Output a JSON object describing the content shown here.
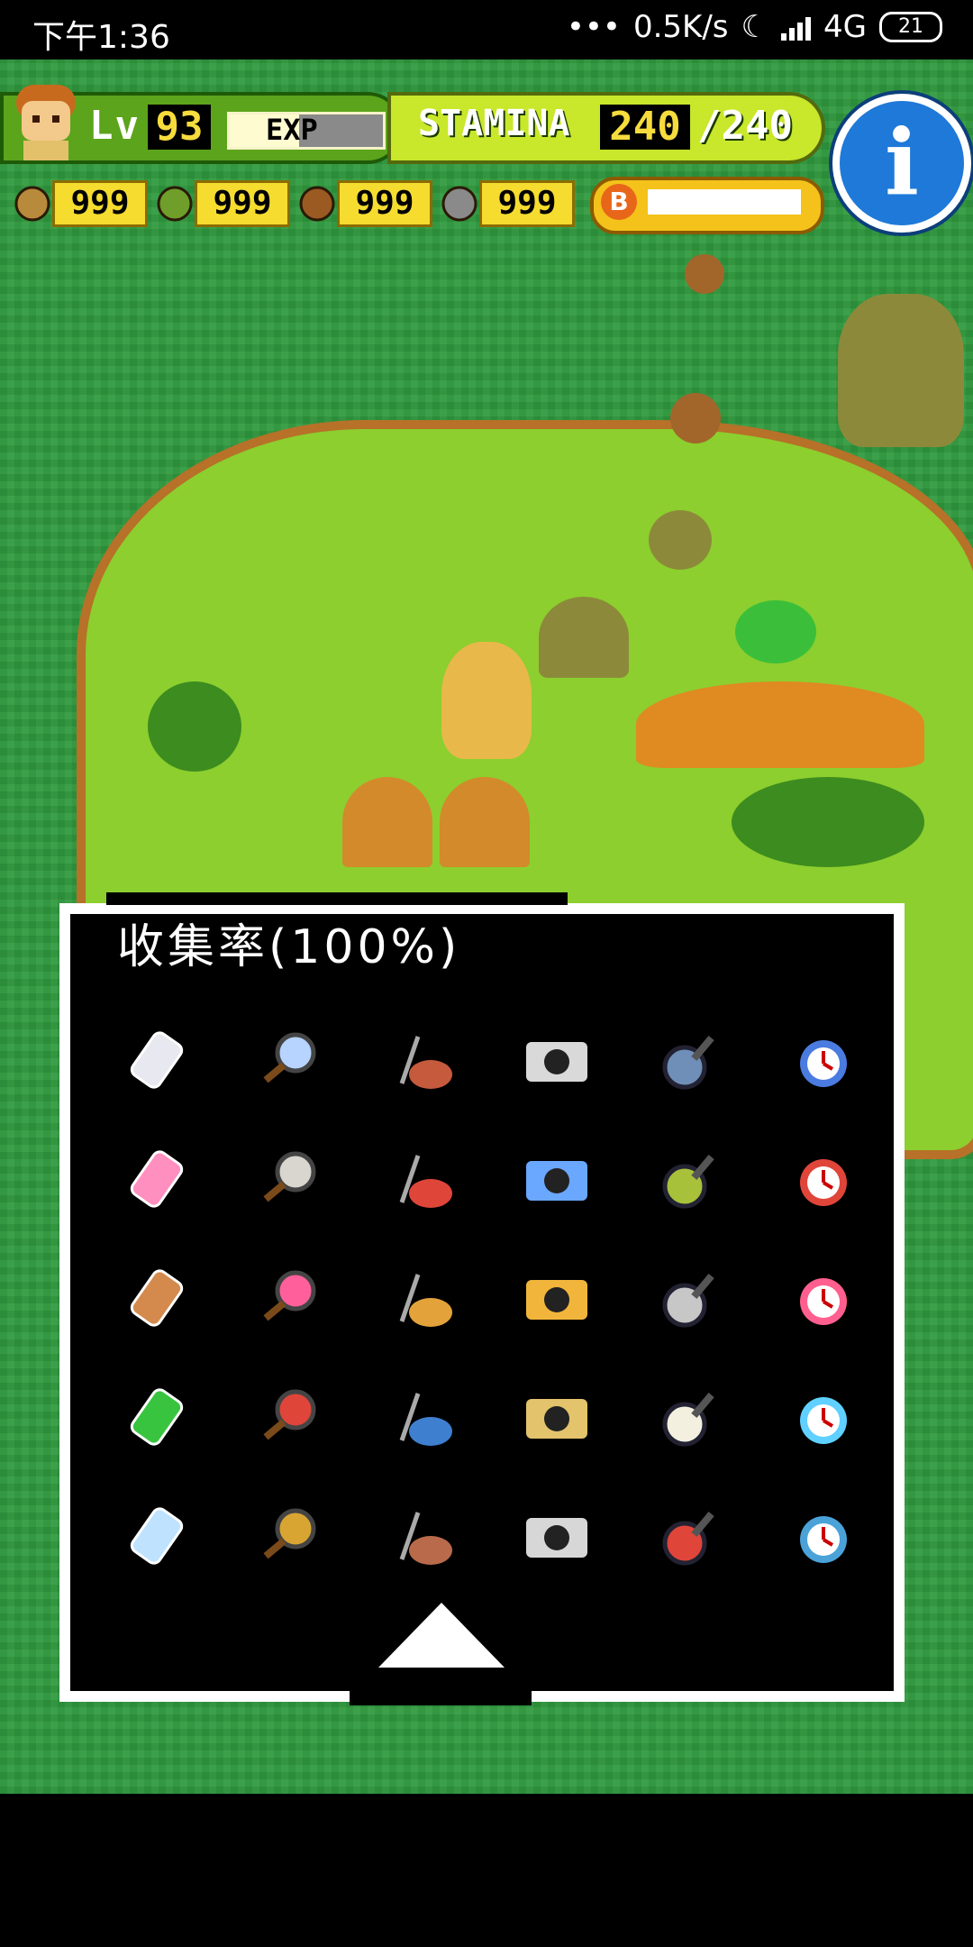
{
  "status_bar": {
    "time": "下午1:36",
    "network_speed": "0.5K/s",
    "network_type": "4G",
    "battery": "21"
  },
  "hud": {
    "level_label": "Lv",
    "level": "93",
    "exp_label": "EXP",
    "exp_fraction": 0.45,
    "stamina_label": "STAMINA",
    "stamina_current": "240",
    "stamina_max": "/240",
    "resources": [
      {
        "icon": "branch-icon",
        "value": "999"
      },
      {
        "icon": "herb-icon",
        "value": "999"
      },
      {
        "icon": "nut-icon",
        "value": "999"
      },
      {
        "icon": "stone-icon",
        "value": "999"
      }
    ],
    "b_badge": "B"
  },
  "panel": {
    "title": "收集率(100%)",
    "items": [
      {
        "icon": "phone-icon",
        "color": "#e8e8f0"
      },
      {
        "icon": "magnifier-icon",
        "color": "#b7d3ff"
      },
      {
        "icon": "vacuum-icon",
        "color": "#c55a3c"
      },
      {
        "icon": "camera-icon",
        "color": "#d9d9d9"
      },
      {
        "icon": "frying-pan-icon",
        "color": "#6f8fb8"
      },
      {
        "icon": "alarm-clock-icon",
        "color": "#4a7be0"
      },
      {
        "icon": "underwear-icon",
        "color": "#ff8fbf"
      },
      {
        "icon": "ghost-doll-icon",
        "color": "#d9d6d0"
      },
      {
        "icon": "bicycle-icon",
        "color": "#e0453a"
      },
      {
        "icon": "folding-chair-icon",
        "color": "#6aa7ff"
      },
      {
        "icon": "leaf-umbrella-icon",
        "color": "#a7c13a"
      },
      {
        "icon": "electric-guitar-icon",
        "color": "#e0453a"
      },
      {
        "icon": "acoustic-guitar-icon",
        "color": "#d48a4c"
      },
      {
        "icon": "piano-icon",
        "color": "#ff5f9a"
      },
      {
        "icon": "ring-icon",
        "color": "#e3a23a"
      },
      {
        "icon": "coin-icon",
        "color": "#f2b53b"
      },
      {
        "icon": "silver-ring-icon",
        "color": "#c7c7c7"
      },
      {
        "icon": "gem-icon",
        "color": "#ff5f8f"
      },
      {
        "icon": "green-crystal-icon",
        "color": "#39c43f"
      },
      {
        "icon": "handbag-icon",
        "color": "#e0453a"
      },
      {
        "icon": "card-icon",
        "color": "#3e7fd0"
      },
      {
        "icon": "tape-icon",
        "color": "#e3c36b"
      },
      {
        "icon": "shirt-icon",
        "color": "#f3f0e0"
      },
      {
        "icon": "lightsaber-icon",
        "color": "#5fd0ff"
      },
      {
        "icon": "ice-crystal-icon",
        "color": "#bfe3ff"
      },
      {
        "icon": "gold-book-icon",
        "color": "#d9a532"
      },
      {
        "icon": "bronze-key-icon",
        "color": "#b86a4a"
      },
      {
        "icon": "silver-key-icon",
        "color": "#d7d7d7"
      },
      {
        "icon": "dynamite-icon",
        "color": "#e0453a"
      },
      {
        "icon": "blue-book-icon",
        "color": "#4aa2d8"
      }
    ]
  },
  "colors": {
    "sea": "#2f9a3e",
    "island": "#8ccf2e",
    "shore": "#b77128",
    "info_button": "#1f79d8"
  }
}
